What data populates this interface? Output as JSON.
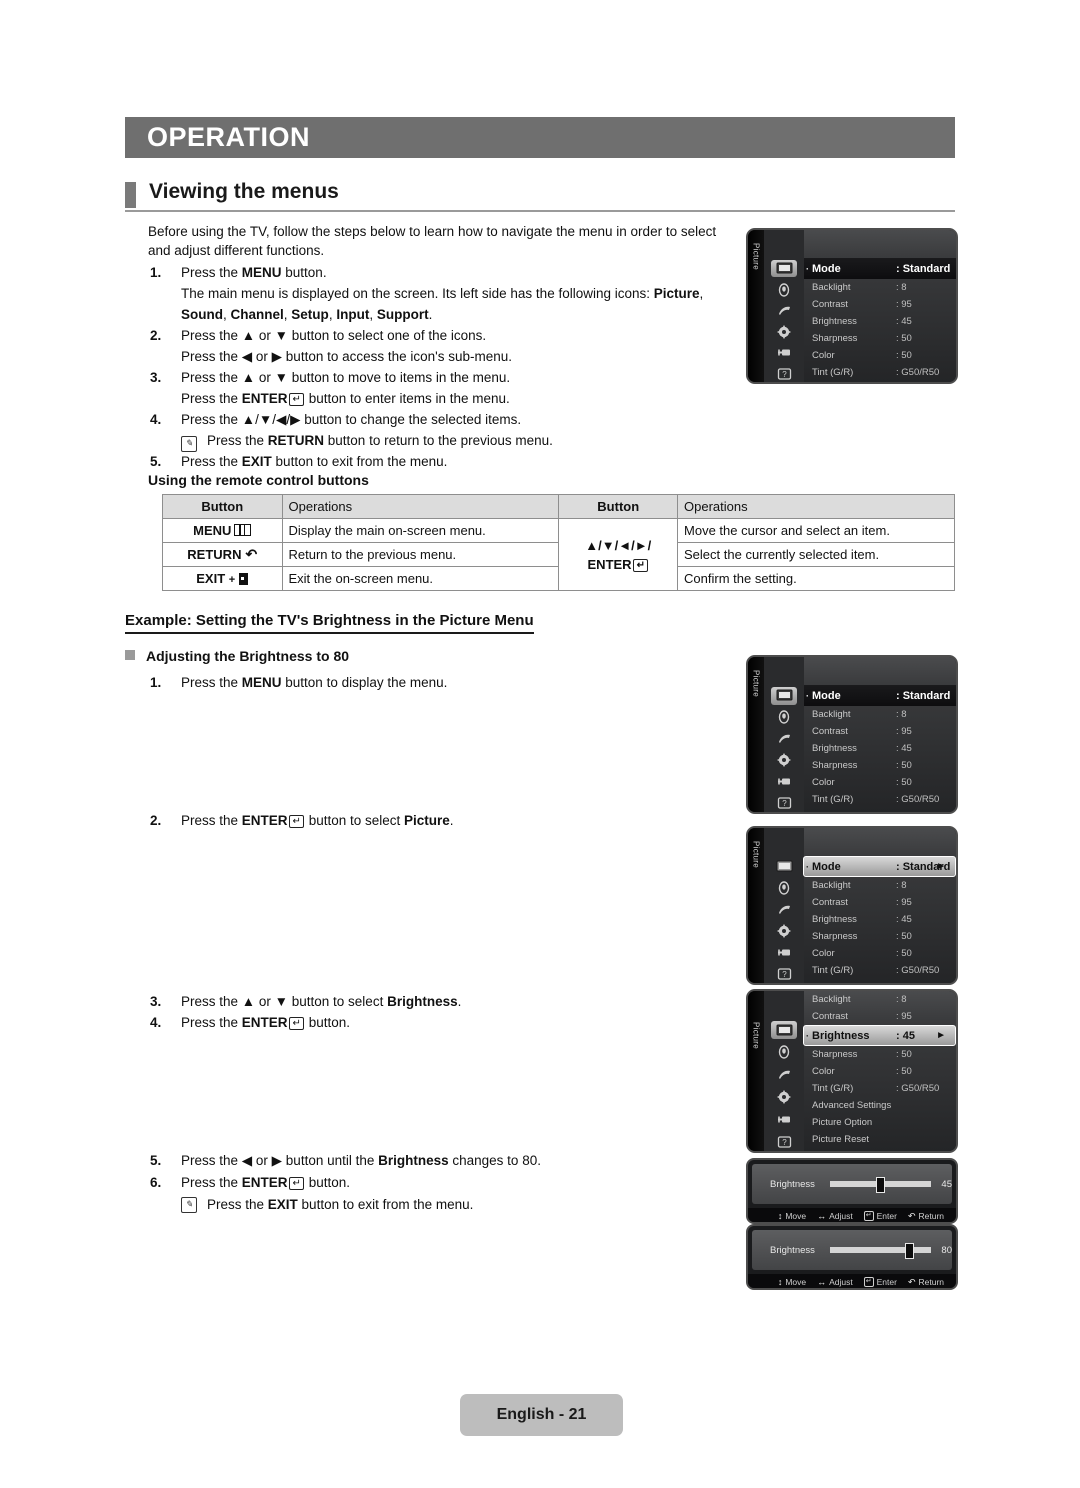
{
  "header": {
    "title": "OPERATION"
  },
  "subhead": {
    "title": "Viewing the menus"
  },
  "intro": "Before using the TV, follow the steps below to learn how to navigate the menu in order to select and adjust different functions.",
  "steps": [
    {
      "num": "1.",
      "lines": [
        "Press the MENU button.",
        "The main menu is displayed on the screen. Its left side has the following icons: Picture, Sound, Channel, Setup, Input, Support."
      ]
    },
    {
      "num": "2.",
      "lines": [
        "Press the ▲ or ▼ button to select one of the icons.",
        "Press the ◄ or ► button to access the icon's sub-menu."
      ]
    },
    {
      "num": "3.",
      "lines": [
        "Press the ▲ or ▼ button to move to items in the menu.",
        "Press the ENTER button to enter items in the menu."
      ]
    },
    {
      "num": "4.",
      "lines": [
        "Press the ▲/▼/◄/► button to change the selected items."
      ]
    },
    {
      "num": "5.",
      "lines": [
        "Press the EXIT button to exit from the menu."
      ]
    }
  ],
  "step4_note": "Press the RETURN button to return to the previous menu.",
  "using_remote_title": "Using the remote control buttons",
  "button_table": {
    "headers": [
      "Button",
      "Operations",
      "Button",
      "Operations"
    ],
    "left_rows": [
      {
        "button": "MENU",
        "operation": "Display the main on-screen menu."
      },
      {
        "button": "RETURN",
        "operation": "Return to the previous menu."
      },
      {
        "button": "EXIT",
        "operation": "Exit the on-screen menu."
      }
    ],
    "right_keys": [
      "▲/▼/◄/►/",
      "ENTER"
    ],
    "right_rows": [
      "Move the cursor and select an item.",
      "Select the currently selected item.",
      "Confirm the setting."
    ]
  },
  "example": {
    "heading": "Example: Setting the TV's Brightness in the Picture Menu",
    "bullet": "Adjusting the Brightness to 80",
    "steps": [
      {
        "num": "1.",
        "text": "Press the MENU button to display the menu."
      },
      {
        "num": "2.",
        "text": "Press the ENTER button to select Picture."
      },
      {
        "num": "3.",
        "text": "Press the ▲ or ▼ button to select Brightness."
      },
      {
        "num": "4.",
        "text": "Press the ENTER button."
      },
      {
        "num": "5.",
        "text": "Press the ◄ or ► button until the Brightness changes to 80."
      },
      {
        "num": "6.",
        "text": "Press the ENTER button."
      }
    ],
    "note": "Press the EXIT button to exit from the menu."
  },
  "osd": {
    "tab_label": "Picture",
    "icon_names": [
      "picture-icon",
      "sound-icon",
      "channel-icon",
      "setup-icon",
      "input-icon",
      "support-icon"
    ],
    "menu1": {
      "rows": [
        {
          "label": "Mode",
          "value": ": Standard",
          "state": "highlighted"
        },
        {
          "label": "Backlight",
          "value": ": 8",
          "state": "normal"
        },
        {
          "label": "Contrast",
          "value": ": 95",
          "state": "normal"
        },
        {
          "label": "Brightness",
          "value": ": 45",
          "state": "normal"
        },
        {
          "label": "Sharpness",
          "value": ": 50",
          "state": "normal"
        },
        {
          "label": "Color",
          "value": ": 50",
          "state": "normal"
        },
        {
          "label": "Tint (G/R)",
          "value": ": G50/R50",
          "state": "normal"
        }
      ]
    },
    "menu2": {
      "rows": [
        {
          "label": "Mode",
          "value": ": Standard",
          "state": "highlighted"
        },
        {
          "label": "Backlight",
          "value": ": 8",
          "state": "normal"
        },
        {
          "label": "Contrast",
          "value": ": 95",
          "state": "normal"
        },
        {
          "label": "Brightness",
          "value": ": 45",
          "state": "normal"
        },
        {
          "label": "Sharpness",
          "value": ": 50",
          "state": "normal"
        },
        {
          "label": "Color",
          "value": ": 50",
          "state": "normal"
        },
        {
          "label": "Tint (G/R)",
          "value": ": G50/R50",
          "state": "normal"
        }
      ]
    },
    "menu3": {
      "rows": [
        {
          "label": "Mode",
          "value": ": Standard",
          "state": "selected",
          "arrow": "►"
        },
        {
          "label": "Backlight",
          "value": ": 8",
          "state": "normal"
        },
        {
          "label": "Contrast",
          "value": ": 95",
          "state": "normal"
        },
        {
          "label": "Brightness",
          "value": ": 45",
          "state": "normal"
        },
        {
          "label": "Sharpness",
          "value": ": 50",
          "state": "normal"
        },
        {
          "label": "Color",
          "value": ": 50",
          "state": "normal"
        },
        {
          "label": "Tint (G/R)",
          "value": ": G50/R50",
          "state": "normal"
        }
      ]
    },
    "menu4": {
      "rows": [
        {
          "label": "Backlight",
          "value": ": 8",
          "state": "normal"
        },
        {
          "label": "Contrast",
          "value": ": 95",
          "state": "normal"
        },
        {
          "label": "Brightness",
          "value": ": 45",
          "state": "selected",
          "arrow": "►"
        },
        {
          "label": "Sharpness",
          "value": ": 50",
          "state": "normal"
        },
        {
          "label": "Color",
          "value": ": 50",
          "state": "normal"
        },
        {
          "label": "Tint (G/R)",
          "value": ": G50/R50",
          "state": "normal"
        },
        {
          "label": "Advanced Settings",
          "value": "",
          "state": "normal"
        },
        {
          "label": "Picture Option",
          "value": "",
          "state": "normal"
        },
        {
          "label": "Picture Reset",
          "value": "",
          "state": "normal"
        }
      ]
    },
    "slider1": {
      "label": "Brightness",
      "value": "45",
      "percent": 45
    },
    "slider2": {
      "label": "Brightness",
      "value": "80",
      "percent": 80
    },
    "hints": [
      {
        "glyph": "↕",
        "label": "Move"
      },
      {
        "glyph": "↔",
        "label": "Adjust"
      },
      {
        "glyph": "key",
        "label": "Enter"
      },
      {
        "glyph": "↩",
        "label": "Return"
      }
    ]
  },
  "footer": {
    "page_label": "English - 21"
  }
}
